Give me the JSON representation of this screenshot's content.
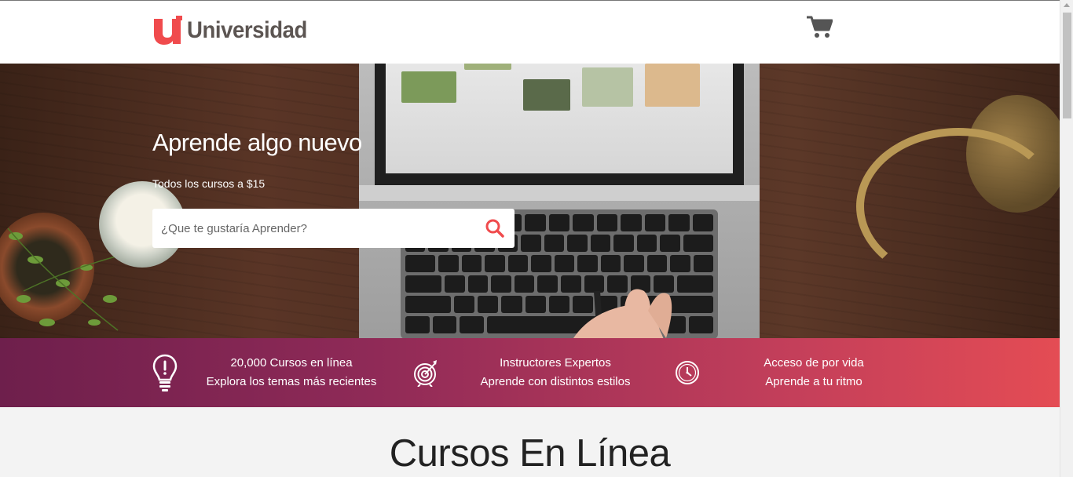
{
  "header": {
    "logo_text": "Universidad",
    "logo_icon": "u-logo-icon",
    "cart_icon": "cart-icon",
    "brand_color": "#f04b4d"
  },
  "hero": {
    "title": "Aprende algo nuevo",
    "subtitle": "Todos los cursos a $15",
    "search_placeholder": "¿Que te gustaría Aprender?",
    "search_icon": "search-icon"
  },
  "features": [
    {
      "icon": "lightbulb-icon",
      "line1": "20,000 Cursos en línea",
      "line2": "Explora los temas más recientes"
    },
    {
      "icon": "target-icon",
      "line1": "Instructores Expertos",
      "line2": "Aprende con distintos estilos"
    },
    {
      "icon": "clock-icon",
      "line1": "Acceso de por vida",
      "line2": "Aprende a tu ritmo"
    }
  ],
  "main": {
    "section_title": "Cursos En Línea"
  },
  "colors": {
    "features_gradient_start": "#6e1f4c",
    "features_gradient_end": "#e44c54",
    "accent": "#f04b4d"
  }
}
